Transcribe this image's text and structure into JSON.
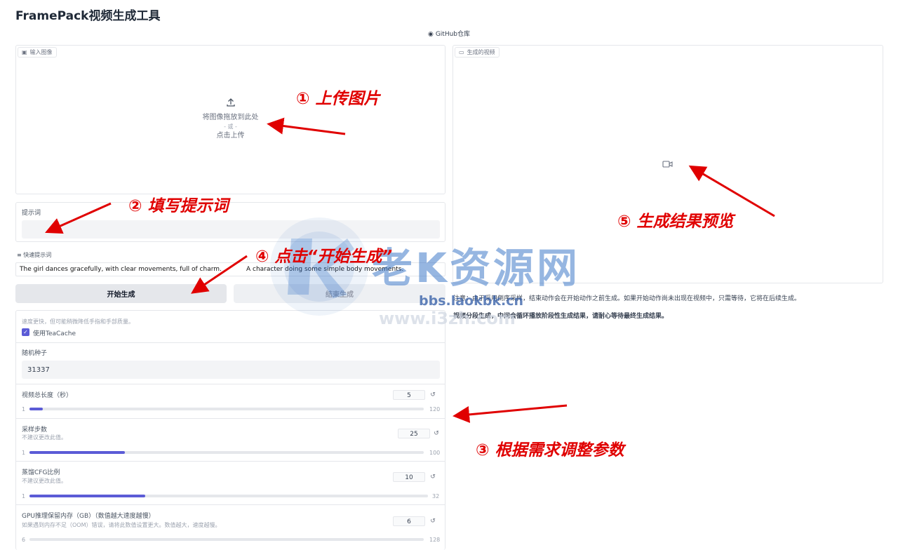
{
  "app": {
    "title": "FramePack视频生成工具",
    "github_link": "GitHub仓库"
  },
  "input_image": {
    "tag": "输入图像",
    "drop_text": "将图像拖放到此处",
    "or_text": "- 或 -",
    "click_text": "点击上传"
  },
  "prompt": {
    "label": "提示词",
    "value": ""
  },
  "quick_prompts": {
    "label": "快速提示词",
    "items": [
      "The girl dances gracefully, with clear movements, full of charm.",
      "A character doing some simple body movements."
    ]
  },
  "buttons": {
    "start": "开始生成",
    "stop": "结束生成"
  },
  "teacache": {
    "desc": "速度更快，但可能稍微降低手指和手部质量。",
    "label": "使用TeaCache",
    "checked": true
  },
  "seed": {
    "label": "随机种子",
    "value": "31337"
  },
  "sliders": [
    {
      "label": "视频总长度（秒）",
      "desc": "",
      "value": "5",
      "min": "1",
      "max": "120",
      "fraction": 0.034
    },
    {
      "label": "采样步数",
      "desc": "不建议更改此值。",
      "value": "25",
      "min": "1",
      "max": "100",
      "fraction": 0.242
    },
    {
      "label": "蒸馏CFG比例",
      "desc": "不建议更改此值。",
      "value": "10",
      "min": "1",
      "max": "32",
      "fraction": 0.29
    },
    {
      "label": "GPU推理保留内存（GB）（数值越大速度越慢）",
      "desc": "如果遇到内存不足（OOM）错误，请将此数值设置更大。数值越大，速度越慢。",
      "value": "6",
      "min": "6",
      "max": "128",
      "fraction": 0.0
    }
  ],
  "output_video": {
    "tag": "生成的视频"
  },
  "notes": {
    "note1": "注意：由于采用倒序采样，结束动作会在开始动作之前生成。如果开始动作尚未出现在视频中，只需等待，它将在后续生成。",
    "note2": "视频分段生成，中间会循环播放阶段性生成结果，请耐心等待最终生成结果。"
  },
  "annotations": {
    "a1": "① 上传图片",
    "a2": "② 填写提示词",
    "a3": "③ 根据需求调整参数",
    "a4": "④ 点击“开始生成”",
    "a5": "⑤ 生成结果预览"
  },
  "watermark": {
    "main": "老K资源网",
    "url": "bbs.laokbk.cn",
    "faint": "www.i3zh.com"
  },
  "colors": {
    "accent": "#5b5bd6",
    "annotation": "#e00000",
    "watermark": "#2f6fc5"
  }
}
